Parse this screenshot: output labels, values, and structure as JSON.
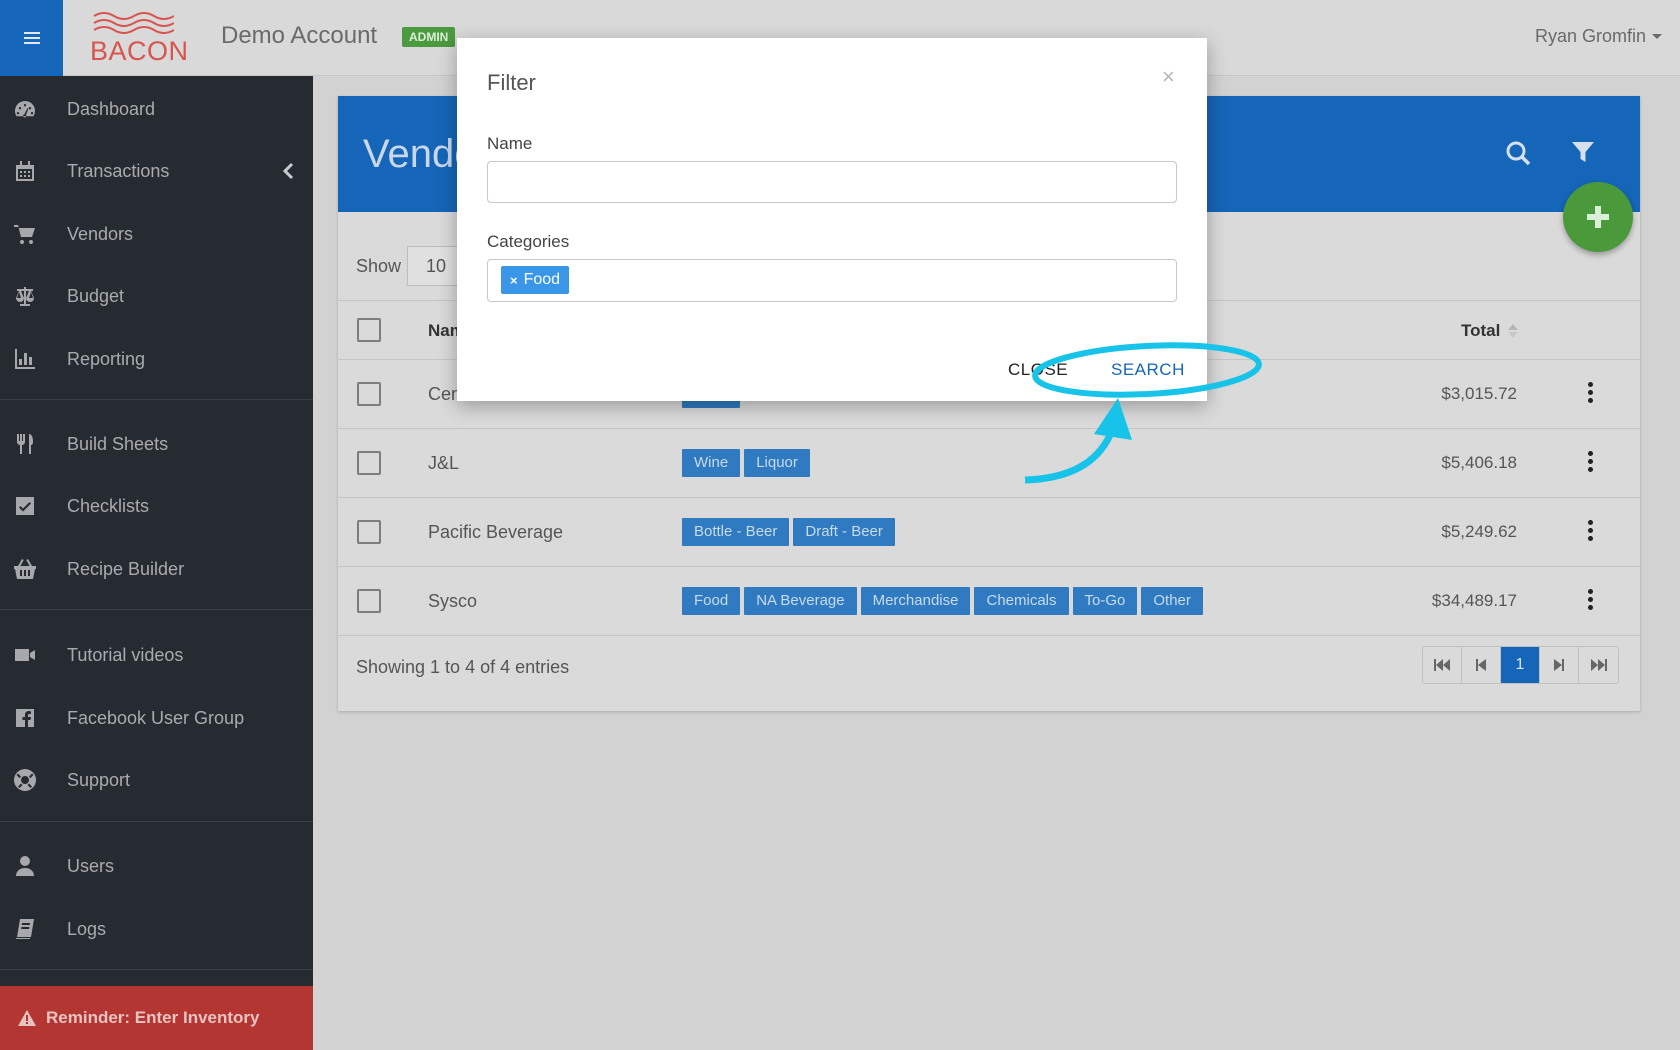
{
  "topbar": {
    "logo_text": "BACON",
    "account_name": "Demo Account",
    "badge": "ADMIN",
    "user": "Ryan Gromfin"
  },
  "sidebar": {
    "items": [
      {
        "label": "Dashboard",
        "icon": "dashboard-icon"
      },
      {
        "label": "Transactions",
        "icon": "calendar-icon"
      },
      {
        "label": "Vendors",
        "icon": "cart-icon"
      },
      {
        "label": "Budget",
        "icon": "scale-icon"
      },
      {
        "label": "Reporting",
        "icon": "bar-chart-icon"
      },
      {
        "label": "Build Sheets",
        "icon": "utensils-icon"
      },
      {
        "label": "Checklists",
        "icon": "checkbox-icon"
      },
      {
        "label": "Recipe Builder",
        "icon": "basket-icon"
      },
      {
        "label": "Tutorial videos",
        "icon": "video-icon"
      },
      {
        "label": "Facebook User Group",
        "icon": "facebook-icon"
      },
      {
        "label": "Support",
        "icon": "life-ring-icon"
      },
      {
        "label": "Users",
        "icon": "user-icon"
      },
      {
        "label": "Logs",
        "icon": "book-icon"
      }
    ],
    "reminder": "Reminder: Enter Inventory"
  },
  "card": {
    "title": "Vendors",
    "show_label": "Show",
    "show_value": "10",
    "columns": {
      "name": "Name",
      "total": "Total"
    },
    "rows": [
      {
        "name": "Central Market",
        "tags": [
          "Food"
        ],
        "total": "$3,015.72"
      },
      {
        "name": "J&L",
        "tags": [
          "Wine",
          "Liquor"
        ],
        "total": "$5,406.18"
      },
      {
        "name": "Pacific Beverage",
        "tags": [
          "Bottle - Beer",
          "Draft - Beer"
        ],
        "total": "$5,249.62"
      },
      {
        "name": "Sysco",
        "tags": [
          "Food",
          "NA Beverage",
          "Merchandise",
          "Chemicals",
          "To-Go",
          "Other"
        ],
        "total": "$34,489.17"
      }
    ],
    "footer": "Showing 1 to 4 of 4 entries",
    "current_page": "1"
  },
  "modal": {
    "title": "Filter",
    "close_glyph": "×",
    "name_label": "Name",
    "name_value": "",
    "categories_label": "Categories",
    "selected_category": "Food",
    "chip_remove": "×",
    "close_button": "CLOSE",
    "search_button": "SEARCH"
  },
  "colors": {
    "primary": "#1565b8",
    "sidebar": "#262b32",
    "success": "#4a9a3b",
    "danger": "#b43632",
    "annotation": "#17c3e8"
  }
}
